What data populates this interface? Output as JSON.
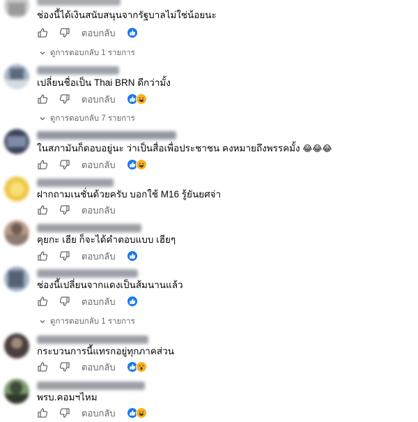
{
  "action_labels": {
    "reply": "ตอบกลับ"
  },
  "comments": [
    {
      "text": "ช่องนี้ได้เงินสนับสนุนจากรัฐบาลไม่ใช่น้อยนะ",
      "reactions": [
        "like"
      ],
      "view_replies": "ดูการตอบกลับ 1 รายการ"
    },
    {
      "text": "เปลี่ยนชื่อเป็น Thai BRN ดีกว่ามั้ง",
      "reactions": [
        "like",
        "laugh"
      ],
      "view_replies": "ดูการตอบกลับ 7 รายการ"
    },
    {
      "text": "ในสภามันก็ดอบอยู่นะ ว่าเป็นสื่อเพื่อประชาชน คงหมายถึงพรรคมั้ง",
      "emoji": "😂😂😂",
      "reactions": [
        "like",
        "laugh"
      ]
    },
    {
      "text": "ฝากถามเนชั่นด้วยครับ บอกใช้ M16 รู้ยันยศจ่า",
      "reactions": []
    },
    {
      "text": "คุยกะ เฮีย ก็จะได้คำตอบแบบ เฮียๆ",
      "reactions": [
        "like"
      ]
    },
    {
      "text": "ช่องนี้เปลี่ยนจากแดงเป็นส้มนานแล้ว",
      "reactions": [
        "like"
      ],
      "view_replies": "ดูการตอบกลับ 1 รายการ"
    },
    {
      "text": "กระบวนการนี้แทรกอยู่ทุกภาคส่วน",
      "reactions": [
        "like",
        "wow"
      ]
    },
    {
      "text": "พรบ.คอมฯไหม",
      "reactions": [
        "like",
        "laugh"
      ]
    }
  ],
  "colors": {
    "text": "#050505",
    "secondary": "#65676b",
    "like_blue": "#1877f2",
    "emoji_yellow": "#f7b125"
  }
}
